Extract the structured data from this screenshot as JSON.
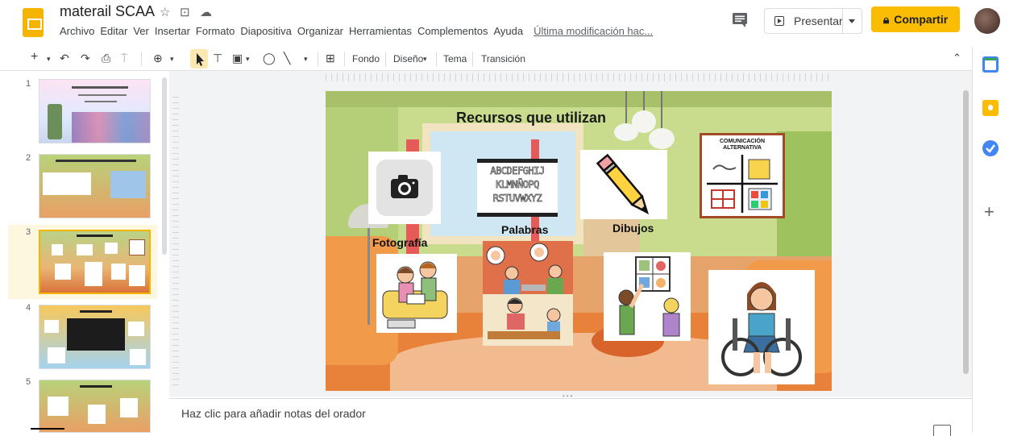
{
  "app": {
    "doc_title": "materail SCAA",
    "menu": [
      "Archivo",
      "Editar",
      "Ver",
      "Insertar",
      "Formato",
      "Diapositiva",
      "Organizar",
      "Herramientas",
      "Complementos",
      "Ayuda"
    ],
    "last_edit": "Última modificación hac...",
    "present_label": "Presentar",
    "share_label": "Compartir"
  },
  "toolbar": {
    "fondo": "Fondo",
    "diseno": "Diseño",
    "tema": "Tema",
    "transicion": "Transición"
  },
  "filmstrip": {
    "slides": [
      {
        "number": "1"
      },
      {
        "number": "2"
      },
      {
        "number": "3",
        "selected": true
      },
      {
        "number": "4"
      },
      {
        "number": "5"
      }
    ]
  },
  "slide": {
    "title": "Recursos que utilizan",
    "captions": {
      "fotografia": "Fotografía",
      "palabras": "Palabras",
      "dibujos": "Dibujos"
    },
    "alphabet_lines": [
      "ABCDEFGHIJ",
      "KLMNÑOPQ",
      "RSTUVWXYZ"
    ],
    "saac_label_line1": "COMUNICACIÓN",
    "saac_label_line2": "ALTERNATIVA"
  },
  "notes": {
    "placeholder": "Haz clic para añadir notas del orador"
  },
  "colors": {
    "brand_yellow": "#f4b400",
    "share_yellow": "#fbbc04",
    "wall_green": "#c5d98a",
    "floor_orange": "#e8823a"
  }
}
